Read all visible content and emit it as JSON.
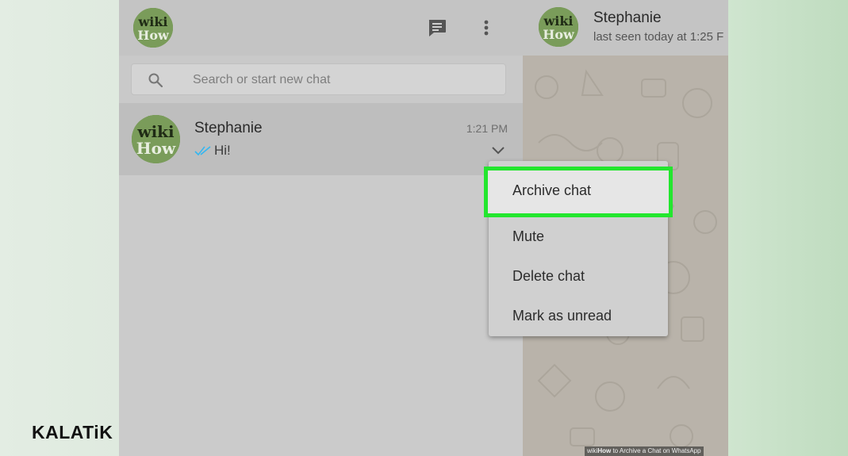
{
  "sidebar": {
    "header": {
      "avatar_logo": {
        "line1": "wiki",
        "line2": "How"
      }
    },
    "search": {
      "placeholder": "Search or start new chat"
    }
  },
  "chats": [
    {
      "name": "Stephanie",
      "time": "1:21 PM",
      "last_message": "Hi!",
      "avatar_logo": {
        "line1": "wiki",
        "line2": "How"
      }
    }
  ],
  "context_menu": {
    "items": [
      {
        "label": "Archive chat",
        "highlighted": true
      },
      {
        "label": "Mute"
      },
      {
        "label": "Delete chat"
      },
      {
        "label": "Mark as unread"
      }
    ]
  },
  "conversation": {
    "contact_name": "Stephanie",
    "status": "last seen today at 1:25 F",
    "avatar_logo": {
      "line1": "wiki",
      "line2": "How"
    }
  },
  "branding": {
    "brand": "KALATiK",
    "caption_prefix": "wiki",
    "caption_bold": "How",
    "caption_text": " to Archive a Chat on WhatsApp"
  },
  "colors": {
    "highlight_border": "#23e62e",
    "read_ticks": "#34b7f1",
    "avatar_green": "#7a9c5a"
  },
  "icons": [
    "new-chat-icon",
    "menu-dots-icon",
    "search-icon",
    "double-check-icon",
    "chevron-down-icon"
  ]
}
